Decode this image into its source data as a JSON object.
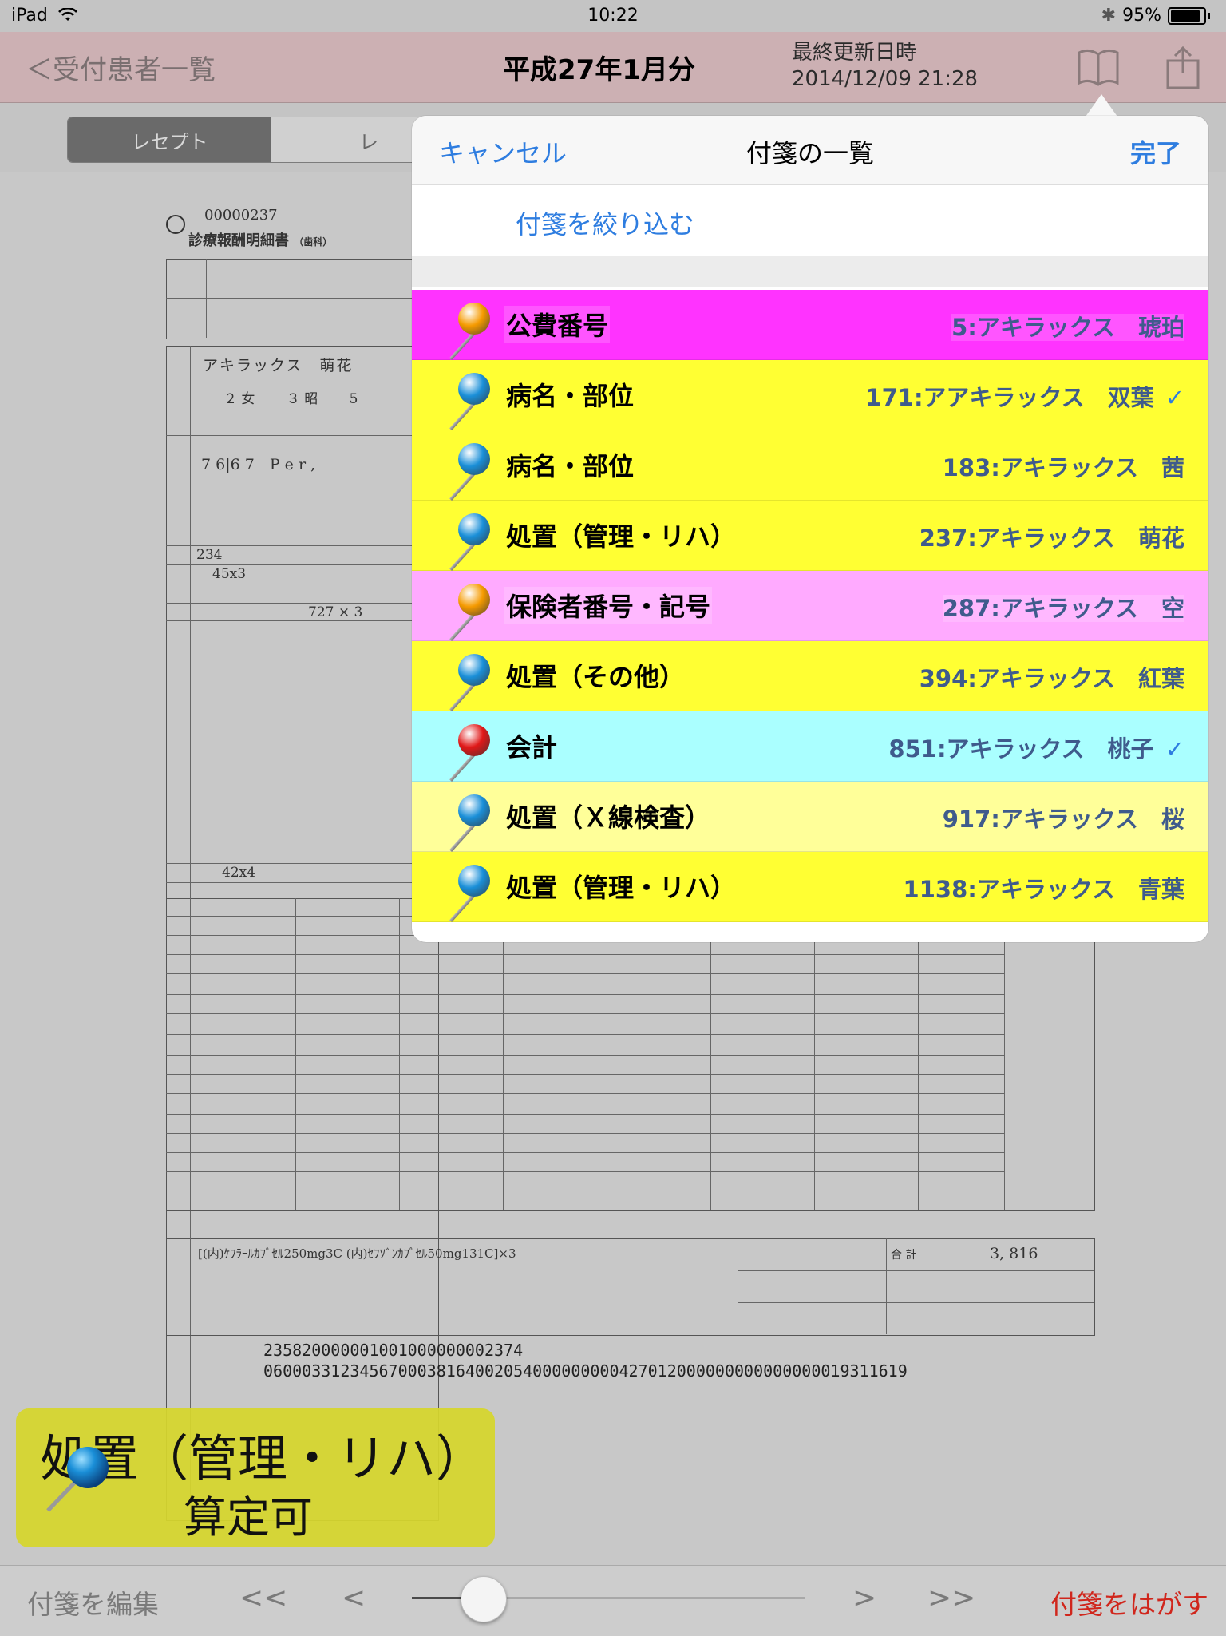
{
  "status": {
    "device": "iPad",
    "time": "10:22",
    "battery": "95%"
  },
  "nav": {
    "back_label": "＜受付患者一覧",
    "title": "平成27年1月分",
    "update_label": "最終更新日時",
    "update_value": "2014/12/09 21:28"
  },
  "segments": [
    "レセプト",
    "レ"
  ],
  "document": {
    "number": "00000237",
    "title": "診療報酬明細書",
    "title_suffix": "（歯科）",
    "patient_name": "アキラックス　萌花",
    "patient_info": "２ 女　　 ３ 昭　　 5",
    "disease": "7 6|6 7　P e r ,",
    "initial_visit": "234",
    "revisit": "45x3",
    "injection": "727 × 3",
    "anesthesia": "42x4",
    "summary_line": "[(内)ｹﾌﾗｰﾙｶﾌﾟｾﾙ250mg3C (内)ｾﾌｿﾞﾝｶﾌﾟｾﾙ50mg131C]×3",
    "total_label": "合 計",
    "total": "3, 816",
    "barcode1": "235820000001001000000002374",
    "barcode2": "0600033123456700038164002054000000000427012000000000000000019311619"
  },
  "popover": {
    "cancel": "キャンセル",
    "title": "付箋の一覧",
    "done": "完了",
    "filter": "付箋を絞り込む",
    "rows": [
      {
        "category": "公費番号",
        "patient": "5:アキラックス　琥珀",
        "checked": false,
        "bg": "#ff33ff",
        "label_bg": "#ff55ff",
        "pin": "#f59a00"
      },
      {
        "category": "病名・部位",
        "patient": "171:アアキラックス　双葉",
        "checked": true,
        "bg": "#ffff33",
        "label_bg": "#ffff33",
        "pin": "#1a8fd8"
      },
      {
        "category": "病名・部位",
        "patient": "183:アキラックス　茜",
        "checked": false,
        "bg": "#ffff33",
        "label_bg": "#ffff33",
        "pin": "#1a8fd8"
      },
      {
        "category": "処置（管理・リハ）",
        "patient": "237:アキラックス　萌花",
        "checked": false,
        "bg": "#ffff33",
        "label_bg": "#ffff33",
        "pin": "#1a8fd8"
      },
      {
        "category": "保険者番号・記号",
        "patient": "287:アキラックス　空",
        "checked": false,
        "bg": "#ffaaff",
        "label_bg": "#ffb8ff",
        "pin": "#f59a00"
      },
      {
        "category": "処置（その他）",
        "patient": "394:アキラックス　紅葉",
        "checked": false,
        "bg": "#ffff33",
        "label_bg": "#ffff33",
        "pin": "#1a8fd8"
      },
      {
        "category": "会計",
        "patient": "851:アキラックス　桃子",
        "checked": true,
        "bg": "#aaffff",
        "label_bg": "#aaffff",
        "pin": "#e01818"
      },
      {
        "category": "処置（Ｘ線検査）",
        "patient": "917:アキラックス　桜",
        "checked": false,
        "bg": "#ffff99",
        "label_bg": "#ffff99",
        "pin": "#1a8fd8"
      },
      {
        "category": "処置（管理・リハ）",
        "patient": "1138:アキラックス　青葉",
        "checked": false,
        "bg": "#ffff33",
        "label_bg": "#ffff33",
        "pin": "#1a8fd8"
      }
    ]
  },
  "sticky": {
    "line1": "処置（管理・リハ）",
    "line2": "算定可",
    "color": "#d6d62c"
  },
  "toolbar": {
    "edit": "付箋を編集",
    "first": "<<",
    "prev": "<",
    "next": ">",
    "last": ">>",
    "peel": "付箋をはがす",
    "slider_value": 0.18
  }
}
